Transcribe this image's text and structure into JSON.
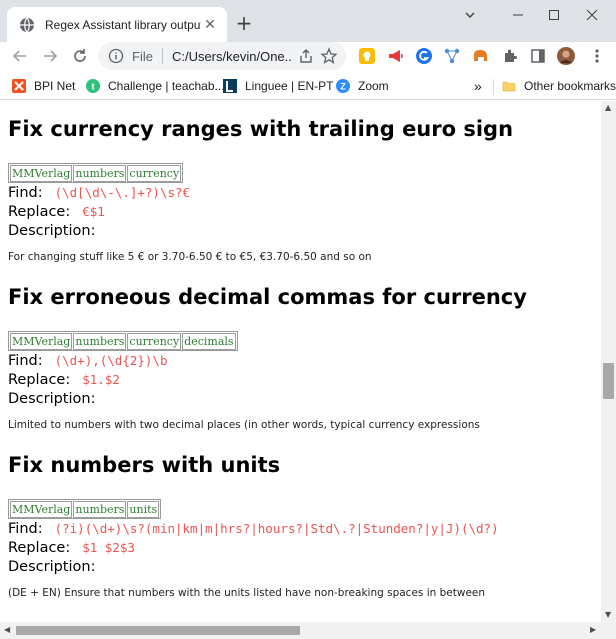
{
  "browser": {
    "tab_title": "Regex Assistant library output KS",
    "tab_close": "✕",
    "new_tab": "+",
    "window_controls": {
      "dropdown": "⌄",
      "minimize": "—",
      "maximize": "☐",
      "close": "✕"
    },
    "omnibox": {
      "prefix": "File",
      "url": "C:/Users/kevin/One..."
    },
    "icons": [
      "back-icon",
      "forward-icon",
      "reload-icon",
      "info-icon",
      "share-icon",
      "star-icon",
      "extensions-icon",
      "side-panel-icon",
      "profile-avatar"
    ]
  },
  "bookmarks": {
    "items": [
      {
        "label": "BPI Net",
        "icon": "bpi-icon",
        "color": "#f4511e"
      },
      {
        "label": "Challenge | teachab...",
        "icon": "teachable-icon",
        "color": "#2ec27e"
      },
      {
        "label": "Linguee | EN-PT",
        "icon": "linguee-icon",
        "color": "#0b3d5c"
      },
      {
        "label": "Zoom",
        "icon": "zoom-icon",
        "color": "#2d8cff"
      }
    ],
    "overflow": "»",
    "other": "Other bookmarks"
  },
  "entries": [
    {
      "title": "Fix currency ranges with trailing euro sign",
      "tags": [
        "MMVerlag",
        "numbers",
        "currency"
      ],
      "find_label": "Find:",
      "find": "(\\d[\\d\\-\\.]+?)\\s?€",
      "replace_label": "Replace:",
      "replace": "€$1",
      "description_label": "Description:",
      "description": "For changing stuff like 5 € or 3.70-6.50 € to €5, €3.70-6.50 and so on"
    },
    {
      "title": "Fix erroneous decimal commas for currency",
      "tags": [
        "MMVerlag",
        "numbers",
        "currency",
        "decimals"
      ],
      "find_label": "Find:",
      "find": "(\\d+),(\\d{2})\\b",
      "replace_label": "Replace:",
      "replace": "$1.$2",
      "description_label": "Description:",
      "description": "Limited to numbers with two decimal places (in other words, typical currency expressions"
    },
    {
      "title": "Fix numbers with units",
      "tags": [
        "MMVerlag",
        "numbers",
        "units"
      ],
      "find_label": "Find:",
      "find": "(?i)(\\d+)\\s?(min|km|m|hrs?|hours?|Std\\.?|Stunden?|y|J)(\\d?)",
      "replace_label": "Replace:",
      "replace": "$1 $2$3",
      "description_label": "Description:",
      "description": "(DE + EN) Ensure that numbers with the units listed have non-breaking spaces in between"
    }
  ],
  "colors": {
    "code": "#ef5350",
    "tag": "#2e7d32",
    "tabstrip": "#dee1e6"
  }
}
